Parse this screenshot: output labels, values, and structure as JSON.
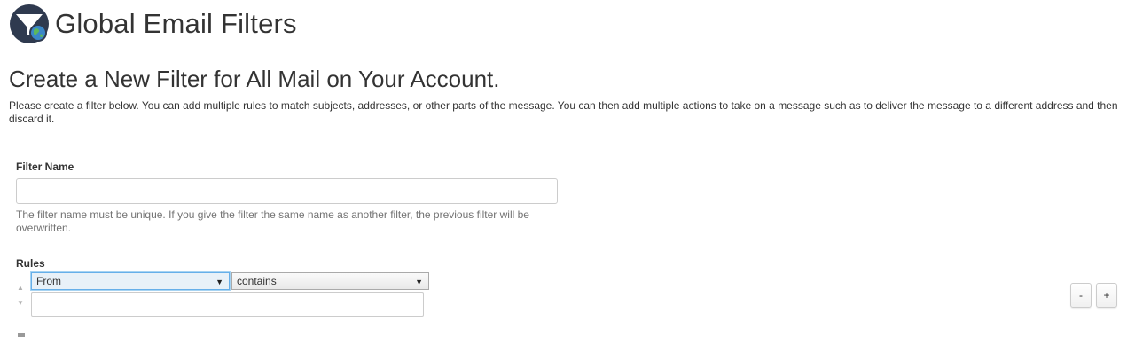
{
  "header": {
    "title": "Global Email Filters",
    "icon": "filter-globe-icon"
  },
  "section": {
    "heading": "Create a New Filter for All Mail on Your Account.",
    "intro": "Please create a filter below. You can add multiple rules to match subjects, addresses, or other parts of the message. You can then add multiple actions to take on a message such as to deliver the message to a different address and then discard it."
  },
  "filter_name": {
    "label": "Filter Name",
    "value": "",
    "placeholder": "",
    "help": "The filter name must be unique. If you give the filter the same name as another filter, the previous filter will be overwritten."
  },
  "rules": {
    "label": "Rules",
    "field_select": "From",
    "operator_select": "contains",
    "value": "",
    "move_up_icon": "caret-up-icon",
    "move_down_icon": "caret-down-icon",
    "remove_label": "-",
    "add_label": "+"
  },
  "colors": {
    "icon_bg": "#2f3a4f",
    "focus_border": "#66afe9"
  }
}
